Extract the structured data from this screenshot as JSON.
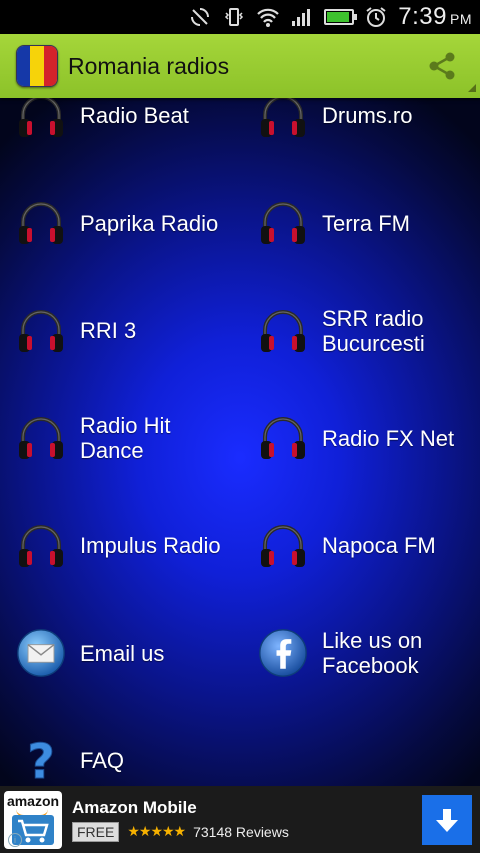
{
  "status_bar": {
    "time": "7:39",
    "ampm": "PM",
    "battery_level": 0.9,
    "icons": [
      "sync-off-icon",
      "vibrate-icon",
      "wifi-icon",
      "signal-icon",
      "battery-icon",
      "alarm-icon"
    ]
  },
  "action_bar": {
    "title": "Romania radios",
    "app_icon": "romania-flag-icon",
    "share_icon": "share-icon",
    "flag_colors": [
      "#1538a8",
      "#f6d30a",
      "#d3232b"
    ],
    "accent": "#9acb30"
  },
  "items": [
    {
      "label": "Radio Beat",
      "icon": "headphones-icon"
    },
    {
      "label": "Drums.ro",
      "icon": "headphones-icon"
    },
    {
      "label": "Paprika Radio",
      "icon": "headphones-icon"
    },
    {
      "label": "Terra FM",
      "icon": "headphones-icon"
    },
    {
      "label": "RRI 3",
      "icon": "headphones-icon"
    },
    {
      "label": "SRR radio Bucurcesti",
      "icon": "headphones-icon"
    },
    {
      "label": "Radio Hit Dance",
      "icon": "headphones-icon"
    },
    {
      "label": "Radio FX Net",
      "icon": "headphones-icon"
    },
    {
      "label": "Impulus Radio",
      "icon": "headphones-icon"
    },
    {
      "label": "Napoca FM",
      "icon": "headphones-icon"
    },
    {
      "label": "Email us",
      "icon": "email-icon"
    },
    {
      "label": "Like us on Facebook",
      "icon": "facebook-icon"
    },
    {
      "label": "FAQ",
      "icon": "question-mark-icon"
    }
  ],
  "ad": {
    "logo_text": "amazon",
    "title": "Amazon Mobile",
    "price_badge": "FREE",
    "rating": 4.5,
    "reviews": "73148 Reviews",
    "info_icon": "info-icon",
    "download_icon": "download-arrow-icon",
    "button_color": "#1a6fe8"
  }
}
